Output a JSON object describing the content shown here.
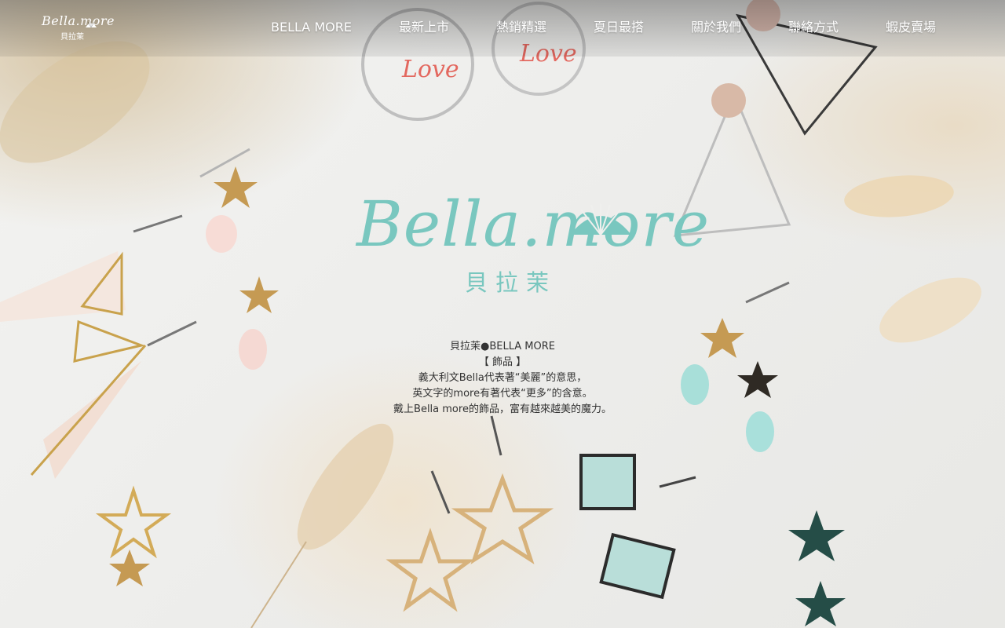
{
  "brand": {
    "script": "Bella.more",
    "zh": "貝拉茉"
  },
  "nav": {
    "items": [
      {
        "label": "BELLA MORE"
      },
      {
        "label": "最新上市"
      },
      {
        "label": "熱銷精選"
      },
      {
        "label": "夏日最搭"
      },
      {
        "label": "關於我們"
      },
      {
        "label": "聯絡方式"
      },
      {
        "label": "蝦皮賣場"
      }
    ]
  },
  "hero": {
    "logo_script": "Bella.more",
    "logo_zh": "貝拉茉",
    "intro": [
      "貝拉茉●BELLA MORE",
      "【 飾品 】",
      "義大利文Bella代表著“美麗”的意思，",
      "英文字的more有著代表“更多”的含意。",
      "戴上Bella more的飾品，富有越來越美的魔力。"
    ],
    "decor_text": "Love"
  },
  "colors": {
    "brand_teal": "#79c7bf",
    "nav_text": "#ffffff",
    "body_text": "#333333"
  }
}
